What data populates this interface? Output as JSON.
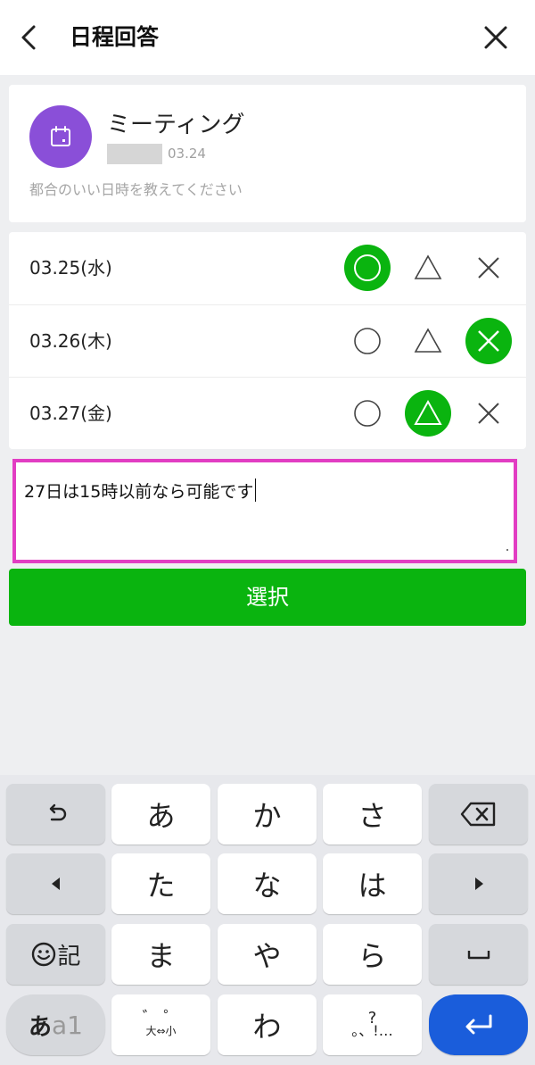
{
  "header": {
    "title": "日程回答",
    "back_icon": "chevron-left-icon",
    "close_icon": "close-icon"
  },
  "event": {
    "name": "ミーティング",
    "date": "03.24",
    "description": "都合のいい日時を教えてください",
    "icon": "calendar-icon",
    "avatar_color": "#8a4fd8"
  },
  "dates": [
    {
      "label": "03.25(水)",
      "selected": "circle"
    },
    {
      "label": "03.26(木)",
      "selected": "cross"
    },
    {
      "label": "03.27(金)",
      "selected": "triangle"
    }
  ],
  "comment": {
    "value": "27日は15時以前なら可能です"
  },
  "select_button": {
    "label": "選択"
  },
  "colors": {
    "accent": "#0ab40f",
    "highlight_border": "#e23dc3",
    "enter_key": "#1a5ddb"
  },
  "keyboard": {
    "row1": [
      "あ",
      "か",
      "さ"
    ],
    "row2": [
      "た",
      "な",
      "は"
    ],
    "row3": [
      "ま",
      "や",
      "ら"
    ],
    "row4_center": "わ",
    "emoji_label": "記",
    "mode_label_a": "あ",
    "mode_label_b": "a1",
    "small_key_top": "゛ ゜",
    "small_key_bottom": "大⇔小",
    "punct_top": "?",
    "punct_bottom": "。、!…",
    "undo_icon": "undo-icon",
    "backspace_icon": "backspace-icon",
    "left_icon": "arrow-left-icon",
    "right_icon": "arrow-right-icon",
    "space_icon": "space-icon",
    "enter_icon": "enter-icon"
  }
}
